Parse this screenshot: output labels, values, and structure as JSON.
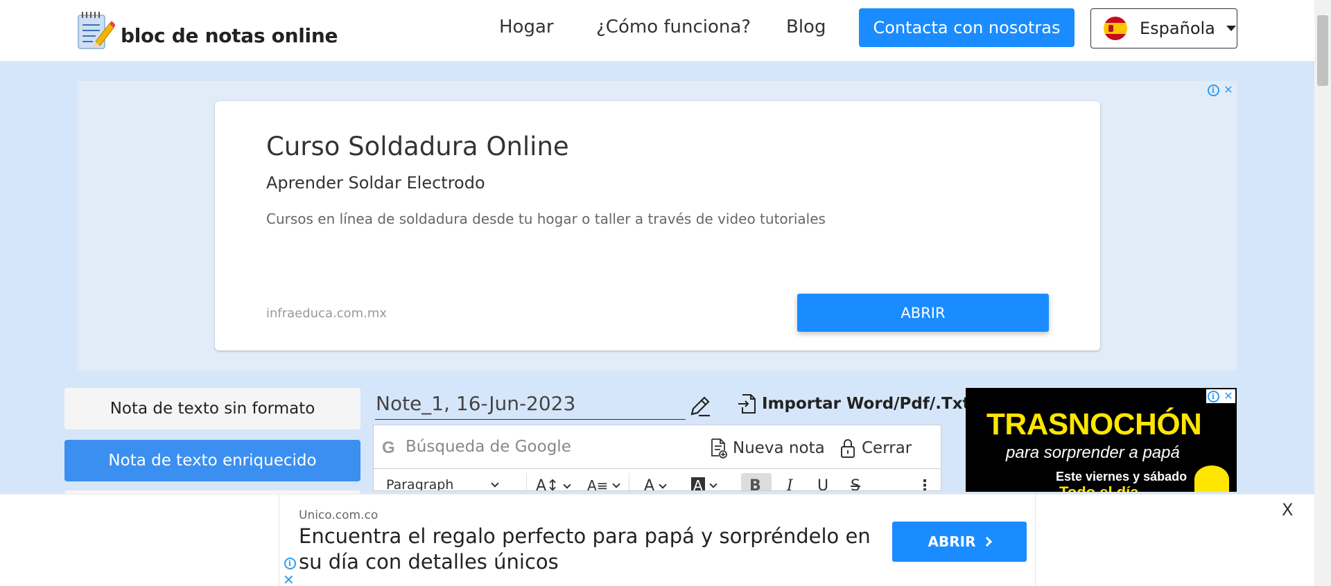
{
  "header": {
    "logo_text": "bloc de notas online",
    "nav": [
      "Hogar",
      "¿Cómo funciona?",
      "Blog"
    ],
    "contact_label": "Contacta con nosotras",
    "language_label": "Española"
  },
  "ad_top": {
    "title": "Curso Soldadura Online",
    "subtitle": "Aprender Soldar Electrodo",
    "description": "Cursos en línea de soldadura desde tu hogar o taller a través de video tutoriales",
    "domain": "infraeduca.com.mx",
    "button": "ABRIR"
  },
  "sidebar": {
    "tabs": [
      "Nota de texto sin formato",
      "Nota de texto enriquecido"
    ]
  },
  "editor": {
    "note_title": "Note_1, 16-Jun-2023",
    "import_label": "Importar Word/Pdf/.Txt",
    "search_placeholder": "Búsqueda de Google",
    "new_note": "Nueva nota",
    "close": "Cerrar",
    "format_select": "Paragraph"
  },
  "ad_right": {
    "title": "TRASNOCHÓN",
    "subtitle": "para sorprender a papá",
    "line": "Este viernes y sábado",
    "line2": "Todo el día"
  },
  "ad_bottom": {
    "domain": "Unico.com.co",
    "headline": "Encuentra el regalo perfecto para papá y sorpréndelo en su día con detalles únicos",
    "button": "ABRIR",
    "close": "X"
  },
  "colors": {
    "accent": "#1a8cff",
    "page_bg": "#d6e6fa",
    "tab_active": "#3b8ff0"
  }
}
